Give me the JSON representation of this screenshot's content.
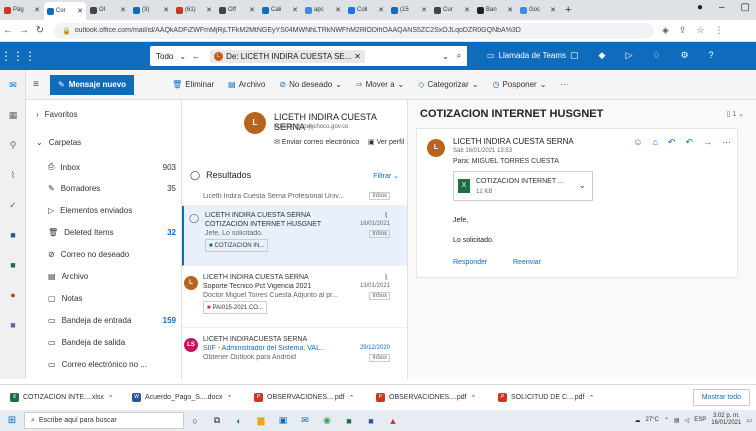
{
  "browser": {
    "tabs": [
      {
        "label": "Pág",
        "color": "#d93025"
      },
      {
        "label": "Cor",
        "color": "#0f6cbd",
        "active": true
      },
      {
        "label": "OI",
        "color": "#444"
      },
      {
        "label": "(3)",
        "color": "#0f6cbd"
      },
      {
        "label": "(61)",
        "color": "#d93025"
      },
      {
        "label": "Off",
        "color": "#444"
      },
      {
        "label": "Cali",
        "color": "#0f6cbd"
      },
      {
        "label": "apc",
        "color": "#4285f4"
      },
      {
        "label": "Coli",
        "color": "#1a73e8"
      },
      {
        "label": "(15",
        "color": "#0f6cbd"
      },
      {
        "label": "Cur",
        "color": "#444"
      },
      {
        "label": "Ban",
        "color": "#222"
      },
      {
        "label": "Goc",
        "color": "#4285f4"
      }
    ],
    "new_tab": "+",
    "url": "outlook.office.com/mail/id/AAQkADFiZWFmMjRjLTFkM2MtNGEyYS04MWNhLTRkNWFhM2RlODlhOAAQANS5ZC2SxOJLqoDZR0GQNbA%3D"
  },
  "outlook": {
    "scope": "Todo",
    "search_chip": "De: LICETH INDIRA CUESTA SE...",
    "search_chip_avatar": "L",
    "teams_label": "Llamada de Teams",
    "new_mail": "Mensaje nuevo",
    "commands": [
      "Eliminar",
      "Archivo",
      "No deseado",
      "Mover a",
      "Categorizar",
      "Posponer",
      "···"
    ],
    "folders": {
      "favorites": "Favoritos",
      "folders": "Carpetas",
      "items": [
        {
          "label": "Inbox",
          "count": "903",
          "count_style": "normal"
        },
        {
          "label": "Borradores",
          "count": "35",
          "count_style": "normal"
        },
        {
          "label": "Elementos enviados",
          "count": "",
          "count_style": "normal"
        },
        {
          "label": "Deleted Items",
          "count": "32",
          "count_style": "blue"
        },
        {
          "label": "Correo no deseado",
          "count": "",
          "count_style": "normal"
        },
        {
          "label": "Archivo",
          "count": "",
          "count_style": "normal"
        },
        {
          "label": "Notas",
          "count": "",
          "count_style": "normal"
        },
        {
          "label": "Bandeja de entrada",
          "count": "159",
          "count_style": "blue"
        },
        {
          "label": "Bandeja de salida",
          "count": "",
          "count_style": "normal"
        },
        {
          "label": "Correo electrónico no ...",
          "count": "",
          "count_style": "normal"
        }
      ]
    },
    "contact": {
      "avatar": "L",
      "name": "LICETH INDIRA CUESTA SERNA",
      "email": "licuesta@codechoco.gov.co",
      "send_email": "Enviar correo electrónico",
      "view_profile": "Ver perfil"
    },
    "list_header": {
      "title": "Resultados",
      "filter": "Filtrar"
    },
    "top_partial": {
      "preview": "Liceth Indira Cuesta Serna Profesional Univ...",
      "tag": "Inbox"
    },
    "messages": [
      {
        "from": "LICETH INDIRA CUESTA SERNA",
        "subject": "COTIZACION INTERNET HUSGNET",
        "preview": "Jefe, Lo solicitado.",
        "date": "16/01/2021",
        "tag": "Inbox",
        "attachment": "COTIZACION IN...",
        "avatar": ""
      },
      {
        "from": "LICETH INDIRA CUESTA SERNA",
        "subject": "Soporte Tecnico Pct Vigencia 2021",
        "preview": "Doctor Miguel Torres Cuesta Adjunto al pr...",
        "date": "13/01/2021",
        "tag": "Inbox",
        "attachment": "PAI015-2021 CO...",
        "avatar": "L"
      },
      {
        "from": "LICETH INDIRACUESTA SERNA",
        "subject": "SIIF - Administrador del Sistema. VAL...",
        "preview": "Obtener Outlook para Android",
        "date": "29/12/2020",
        "tag": "Inbox",
        "attachment": "",
        "avatar": "LS"
      }
    ],
    "reading": {
      "title": "COTIZACION INTERNET HUSGNET",
      "sender": "LICETH INDIRA CUESTA SERNA",
      "sender_avatar": "L",
      "datetime": "Sáb 16/01/2021 13:53",
      "to_label": "Para:",
      "to": "MIGUEL TORRES CUESTA",
      "attachment_name": "COTIZACION INTERNET ...",
      "attachment_size": "12 KB",
      "body_line1": "Jefe,",
      "body_line2": "Lo solicitado.",
      "reply": "Responder",
      "forward": "Reenviar",
      "count": "1"
    }
  },
  "downloads": {
    "items": [
      {
        "name": "COTIZACION INTE....xlsx",
        "color": "#1d6f42",
        "ico": "X"
      },
      {
        "name": "Acuerdo_Pago_S....docx",
        "color": "#2b579a",
        "ico": "W"
      },
      {
        "name": "OBSERVACIONES....pdf",
        "color": "#d93025",
        "ico": "P"
      },
      {
        "name": "OBSERVACIONES....pdf",
        "color": "#d93025",
        "ico": "P"
      },
      {
        "name": "SOLICITUD DE C....pdf",
        "color": "#d93025",
        "ico": "P"
      }
    ],
    "show_all": "Mostrar todo"
  },
  "taskbar": {
    "search_placeholder": "Escribe aquí para buscar",
    "weather": "27°C",
    "lang": "ESP",
    "time": "3:02 p. m.",
    "date": "16/01/2021"
  }
}
